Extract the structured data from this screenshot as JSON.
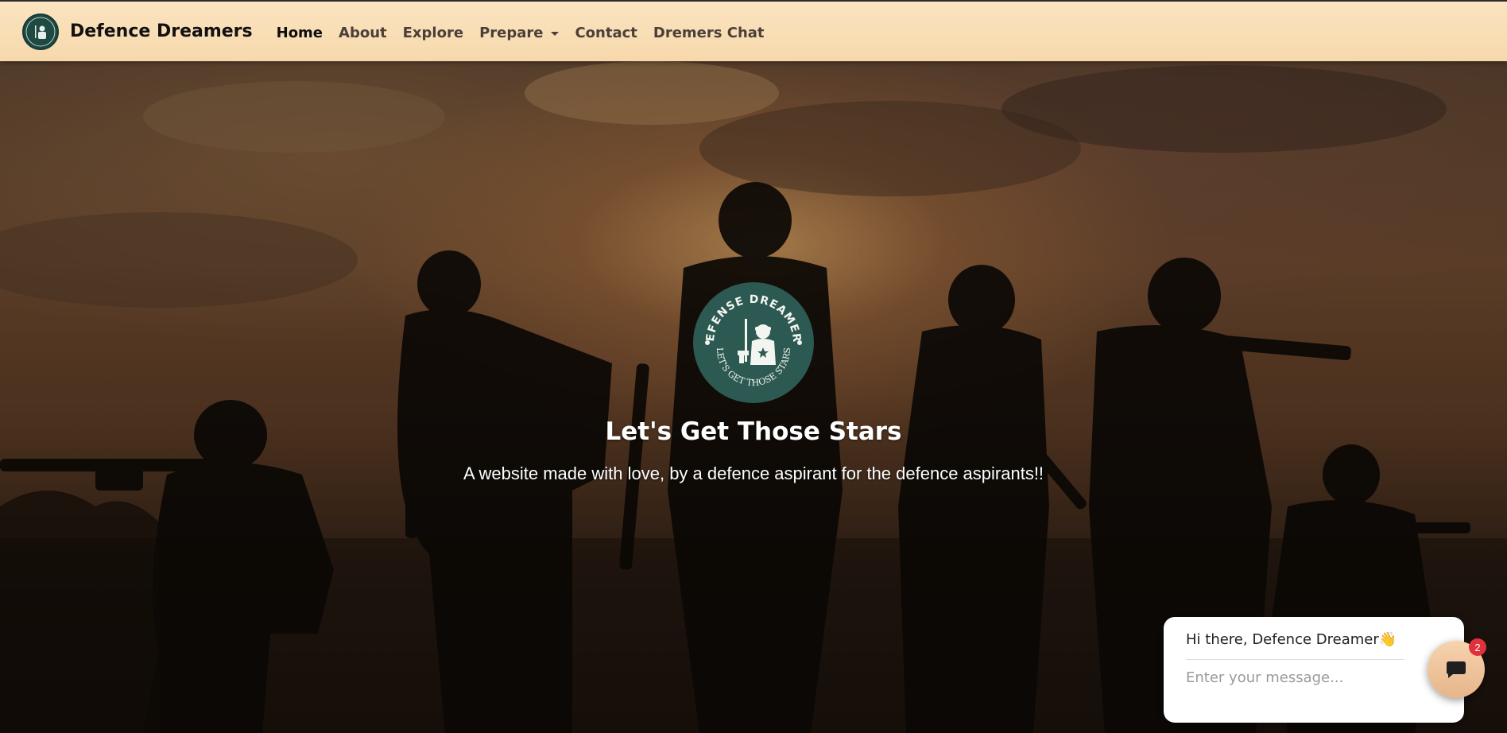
{
  "brand": {
    "name": "Defence Dreamers",
    "logo_text_top": "DEFENSE DREAMERS",
    "logo_text_bottom": "LET'S GET THOSE STARS"
  },
  "nav": {
    "items": [
      {
        "label": "Home",
        "active": true
      },
      {
        "label": "About"
      },
      {
        "label": "Explore"
      },
      {
        "label": "Prepare",
        "dropdown": true
      },
      {
        "label": "Contact"
      },
      {
        "label": "Dremers Chat"
      }
    ]
  },
  "hero": {
    "title": "Let's Get Those Stars",
    "subtitle": "A website made with love, by a defence aspirant for the defence aspirants!!",
    "background": "soldier-silhouettes-sunset"
  },
  "chat": {
    "greeting": "Hi there, Defence Dreamer",
    "greeting_emoji": "👋",
    "input_placeholder": "Enter your message...",
    "badge_count": "2",
    "launcher_icon": "chat-bubble-icon"
  },
  "colors": {
    "navbar_bg": "#f9dfb8",
    "logo_green": "#2c5a52",
    "badge_red": "#e0313d",
    "launcher_bg": "#f0c49c"
  }
}
